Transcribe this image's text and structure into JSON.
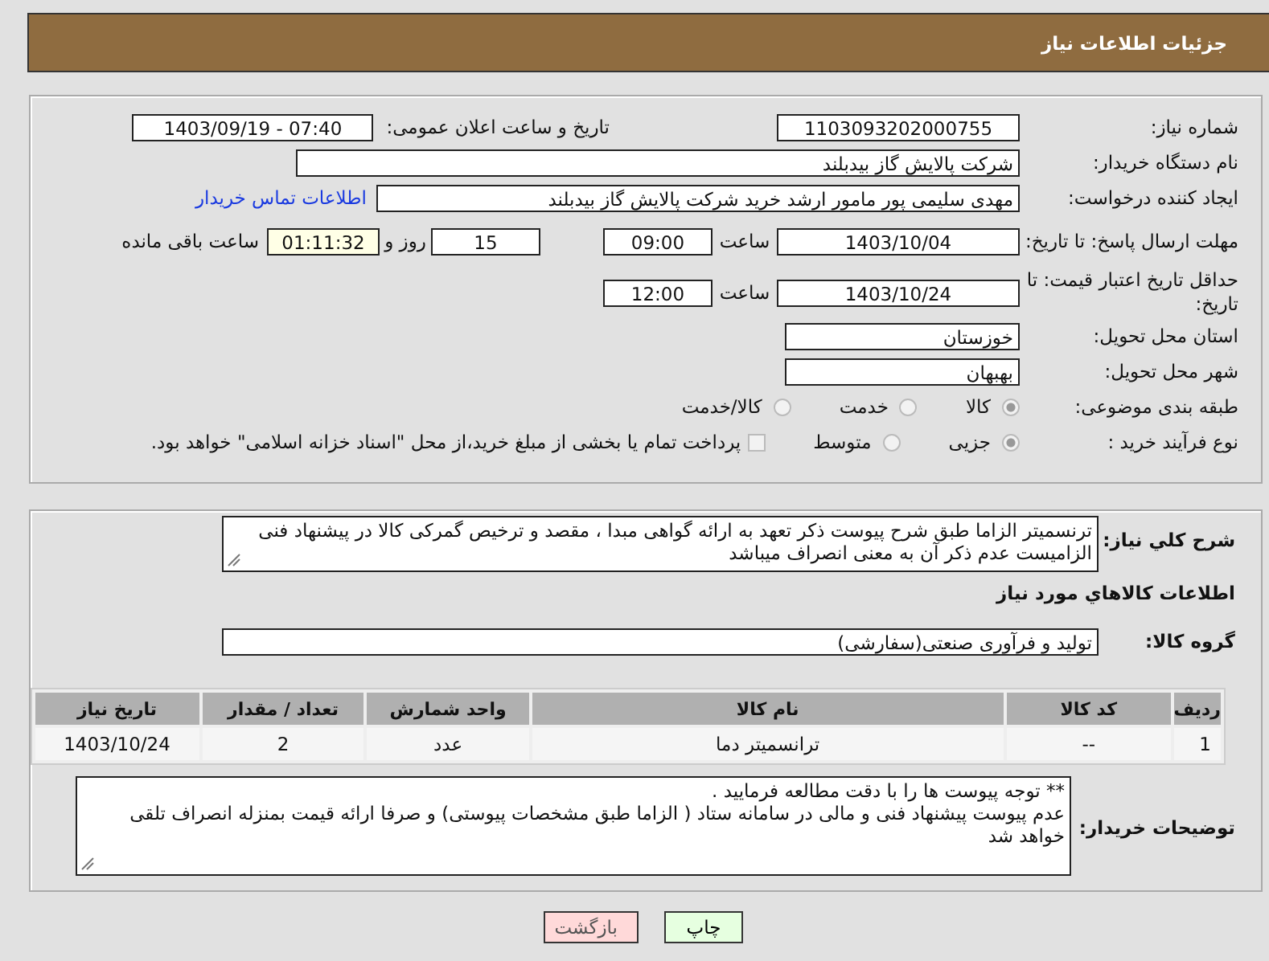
{
  "header": {
    "title": "جزئیات اطلاعات نیاز"
  },
  "need_info": {
    "need_number": {
      "label": "شماره نیاز:",
      "value": "1103093202000755"
    },
    "announce": {
      "label": "تاریخ و ساعت اعلان عمومی:",
      "value": "1403/09/19 - 07:40"
    },
    "buyer": {
      "label": "نام دستگاه خریدار:",
      "value": "شرکت پالایش گاز بیدبلند"
    },
    "creator": {
      "label": "ایجاد کننده درخواست:",
      "value": "مهدی سلیمی پور مامور ارشد خرید شرکت پالایش گاز بیدبلند",
      "link": "اطلاعات تماس خریدار"
    },
    "deadline": {
      "label": "مهلت ارسال پاسخ: تا تاریخ:",
      "date": "1403/10/04",
      "time_label": "ساعت",
      "time": "09:00",
      "days": "15",
      "days_label": "روز و",
      "remaining": "01:11:32",
      "remaining_label": "ساعت باقی مانده"
    },
    "validity": {
      "label": "حداقل تاریخ اعتبار قیمت: تا تاریخ:",
      "date": "1403/10/24",
      "time_label": "ساعت",
      "time": "12:00"
    },
    "province": {
      "label": "استان محل تحویل:",
      "value": "خوزستان"
    },
    "city": {
      "label": "شهر محل تحویل:",
      "value": "بهبهان"
    },
    "category": {
      "label": "طبقه بندی موضوعی:",
      "options": [
        {
          "label": "کالا",
          "selected": true
        },
        {
          "label": "خدمت",
          "selected": false
        },
        {
          "label": "کالا/خدمت",
          "selected": false
        }
      ]
    },
    "process": {
      "label": "نوع فرآیند خرید :",
      "options": [
        {
          "label": "جزیی",
          "selected": true
        },
        {
          "label": "متوسط",
          "selected": false
        }
      ],
      "payment": {
        "checked": false,
        "text": "پرداخت تمام یا بخشی از مبلغ خرید،از محل \"اسناد خزانه اسلامی\" خواهد بود."
      }
    }
  },
  "goods": {
    "description": {
      "label": "شرح کلي نياز:",
      "text": "ترنسمیتر  الزاما طبق شرح  پیوست  ذکر تعهد به ارائه گواهی مبدا ، مقصد و ترخیص گمرکی کالا در پیشنهاد فنی الزامیست عدم ذکر آن به معنی انصراف میباشد"
    },
    "heading": "اطلاعات کالاهاي مورد نياز",
    "group": {
      "label": "گروه کالا:",
      "value": "تولید و فرآوری صنعتی(سفارشی)"
    },
    "table": {
      "columns": [
        "ردیف",
        "کد کالا",
        "نام کالا",
        "واحد شمارش",
        "تعداد / مقدار",
        "تاریخ نیاز"
      ],
      "rows": [
        [
          "1",
          "--",
          "ترانسمیتر دما",
          "عدد",
          "2",
          "1403/10/24"
        ]
      ]
    },
    "buyer_notes": {
      "label": "توضیحات خریدار:",
      "lines": [
        "** توجه پیوست ها  را با دقت مطالعه فرمایید .",
        "عدم پیوست پیشنهاد فنی و مالی در سامانه ستاد ( الزاما طبق مشخصات پیوستی)  و صرفا ارائه قیمت بمنزله انصراف تلقی خواهد شد"
      ]
    }
  },
  "buttons": {
    "print": "چاپ",
    "back": "بازگشت"
  }
}
